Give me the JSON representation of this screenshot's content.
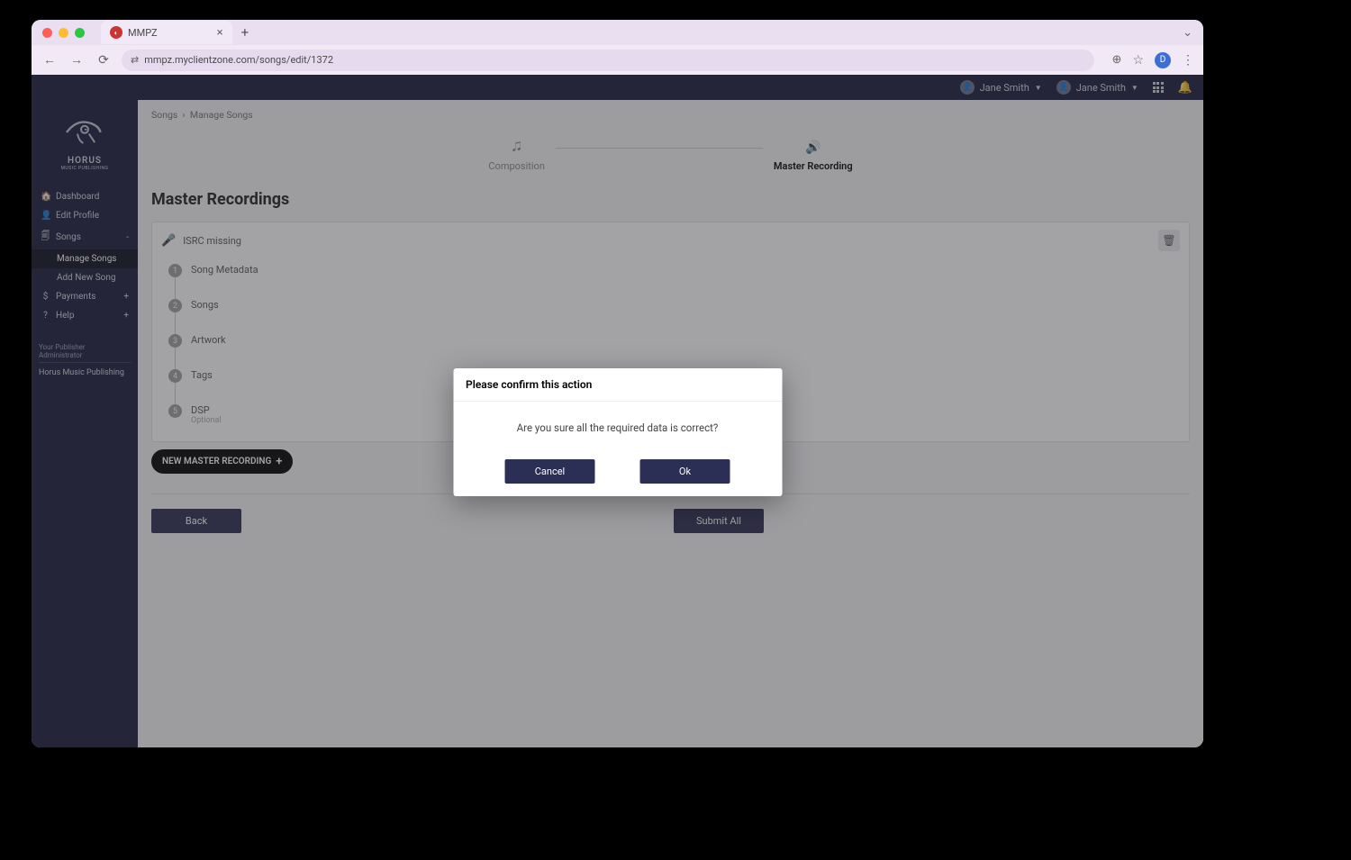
{
  "browser": {
    "tab_title": "MMPZ",
    "url": "mmpz.myclientzone.com/songs/edit/1372",
    "avatar_letter": "D"
  },
  "header": {
    "user_name": "Jane Smith"
  },
  "logo": {
    "name": "HORUS",
    "tagline": "MUSIC PUBLISHING"
  },
  "sidebar": {
    "items": [
      {
        "label": "Dashboard"
      },
      {
        "label": "Edit Profile"
      },
      {
        "label": "Songs",
        "badge": "-"
      },
      {
        "label": "Manage Songs"
      },
      {
        "label": "Add New Song"
      },
      {
        "label": "Payments",
        "badge": "+"
      },
      {
        "label": "Help",
        "badge": "+"
      }
    ],
    "publisher_label": "Your Publisher Administrator",
    "publisher_name": "Horus Music Publishing"
  },
  "breadcrumb": {
    "root": "Songs",
    "current": "Manage Songs"
  },
  "tabs": {
    "composition": "Composition",
    "master": "Master Recording"
  },
  "page": {
    "title": "Master Recordings",
    "isrc_missing": "ISRC missing",
    "steps": [
      {
        "num": "1",
        "label": "Song Metadata"
      },
      {
        "num": "2",
        "label": "Songs"
      },
      {
        "num": "3",
        "label": "Artwork"
      },
      {
        "num": "4",
        "label": "Tags"
      },
      {
        "num": "5",
        "label": "DSP",
        "optional": "Optional"
      }
    ],
    "new_master": "NEW MASTER RECORDING",
    "back": "Back",
    "submit": "Submit All"
  },
  "modal": {
    "title": "Please confirm this action",
    "body": "Are you sure all the required data is correct?",
    "cancel": "Cancel",
    "ok": "Ok"
  }
}
